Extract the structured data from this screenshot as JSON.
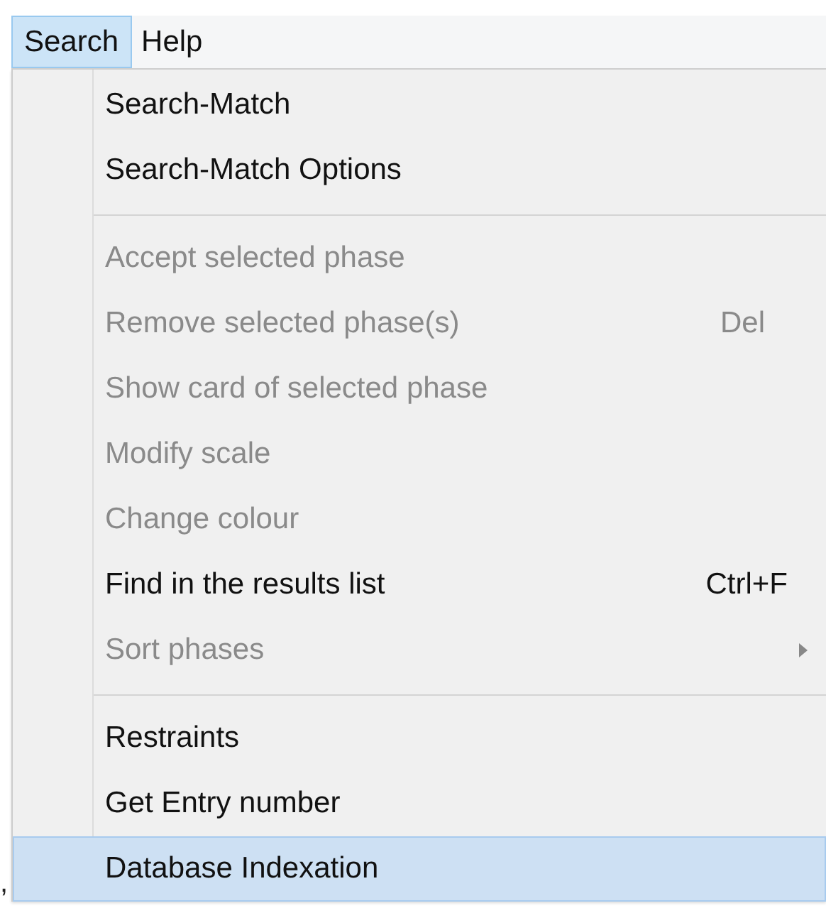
{
  "menu_bar": [
    {
      "label": "Search",
      "selected": true
    },
    {
      "label": "Help",
      "selected": false
    }
  ],
  "menu": [
    {
      "kind": "item",
      "label": "Search-Match",
      "disabled": false,
      "selected": false
    },
    {
      "kind": "item",
      "label": "Search-Match Options",
      "disabled": false,
      "selected": false
    },
    {
      "kind": "separator"
    },
    {
      "kind": "item",
      "label": "Accept selected phase",
      "disabled": true,
      "selected": false
    },
    {
      "kind": "item",
      "label": "Remove selected phase(s)",
      "shortcut": "Del",
      "disabled": true,
      "selected": false
    },
    {
      "kind": "item",
      "label": "Show card of selected phase",
      "disabled": true,
      "selected": false
    },
    {
      "kind": "item",
      "label": "Modify scale",
      "disabled": true,
      "selected": false
    },
    {
      "kind": "item",
      "label": "Change colour",
      "disabled": true,
      "selected": false
    },
    {
      "kind": "item",
      "label": "Find in the results list",
      "shortcut": "Ctrl+F",
      "disabled": false,
      "selected": false
    },
    {
      "kind": "item",
      "label": "Sort phases",
      "submenu": true,
      "disabled": true,
      "selected": false
    },
    {
      "kind": "separator"
    },
    {
      "kind": "item",
      "label": "Restraints",
      "disabled": false,
      "selected": false
    },
    {
      "kind": "item",
      "label": "Get Entry number",
      "disabled": false,
      "selected": false
    },
    {
      "kind": "item",
      "label": "Database Indexation",
      "disabled": false,
      "selected": true
    }
  ],
  "stray_text": ","
}
